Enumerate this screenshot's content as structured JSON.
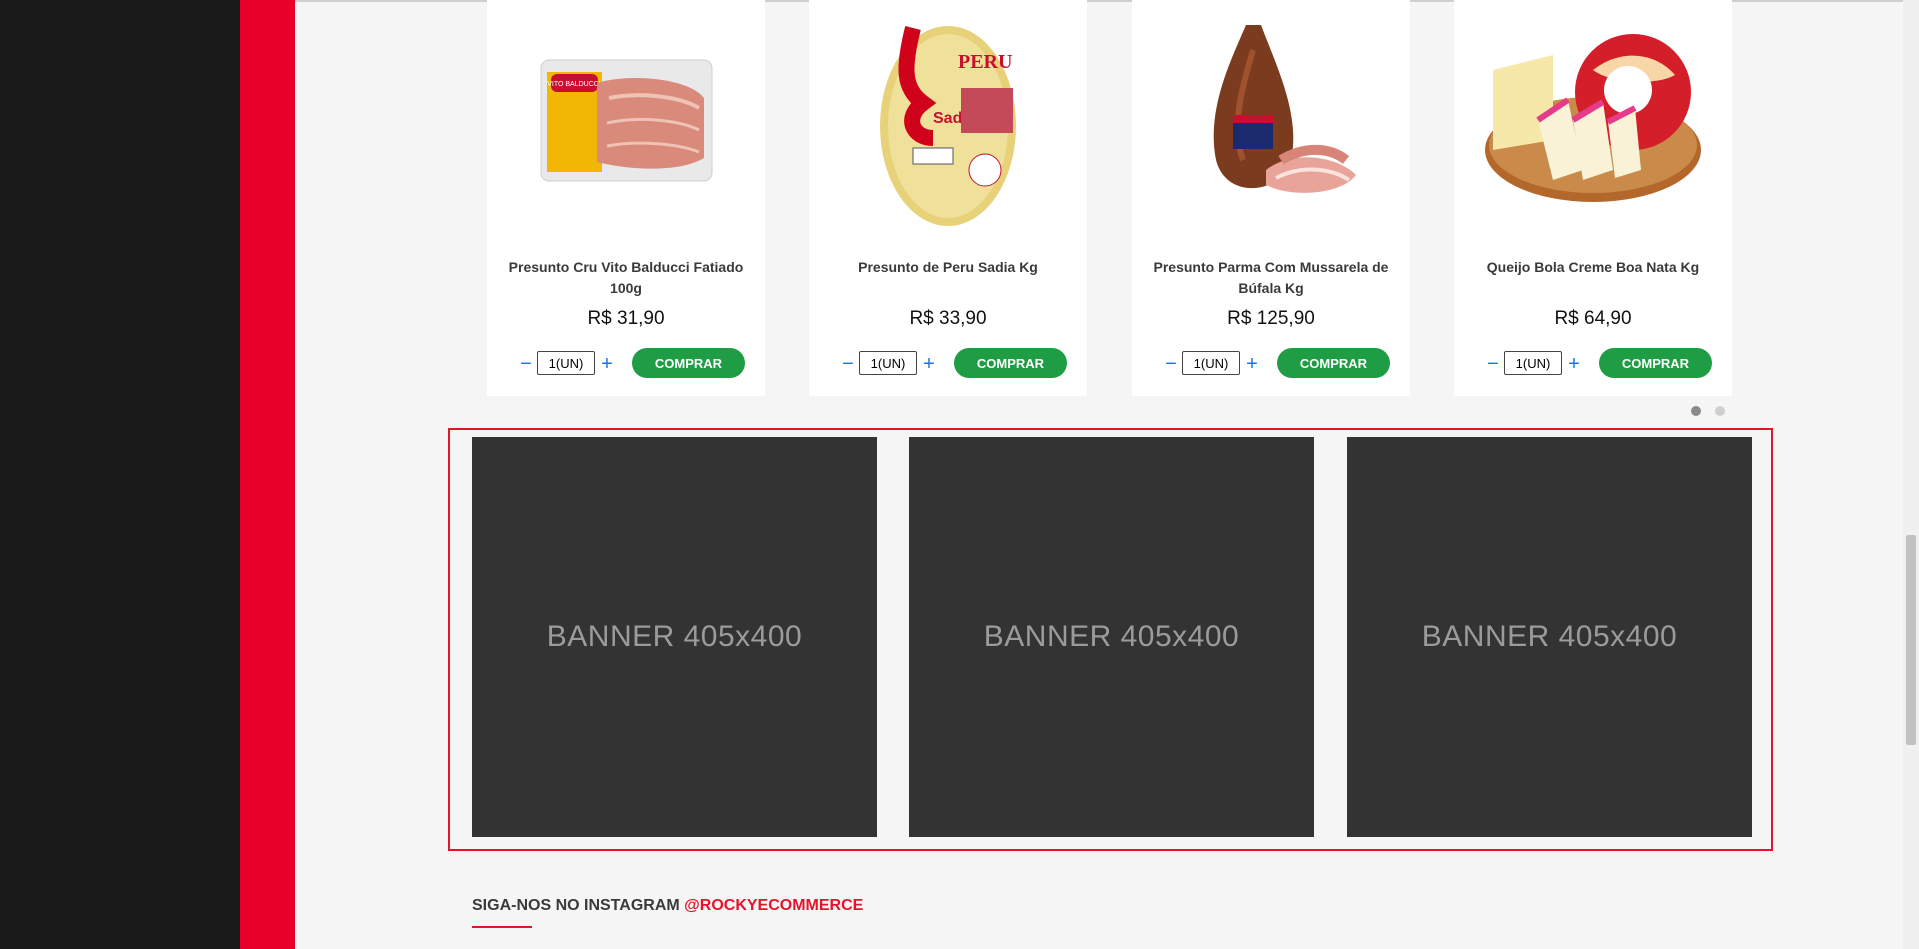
{
  "products": [
    {
      "name": "Presunto Cru Vito Balducci Fatiado 100g",
      "price": "R$ 31,90",
      "qty": "1(UN)",
      "buy_label": "COMPRAR",
      "image_icon": "prosciutto-pack-icon",
      "brand_text": "VITO BALDUCCI"
    },
    {
      "name": "Presunto de Peru Sadia Kg",
      "price": "R$ 33,90",
      "qty": "1(UN)",
      "buy_label": "COMPRAR",
      "image_icon": "turkey-ham-icon",
      "brand_text": "Sadia"
    },
    {
      "name": "Presunto Parma Com Mussarela de Búfala Kg",
      "price": "R$ 125,90",
      "qty": "1(UN)",
      "buy_label": "COMPRAR",
      "image_icon": "parma-ham-icon",
      "brand_text": ""
    },
    {
      "name": "Queijo Bola Creme Boa Nata Kg",
      "price": "R$ 64,90",
      "qty": "1(UN)",
      "buy_label": "COMPRAR",
      "image_icon": "cheese-ball-icon",
      "brand_text": ""
    }
  ],
  "carousel": {
    "pages": 2,
    "active": 0
  },
  "banners": [
    {
      "label": "BANNER 405x400"
    },
    {
      "label": "BANNER 405x400"
    },
    {
      "label": "BANNER 405x400"
    }
  ],
  "instagram": {
    "prefix": "SIGA-NOS NO INSTAGRAM",
    "handle": "@ROCKYECOMMERCE"
  },
  "colors": {
    "accent": "#e8002a",
    "buy_button": "#1f9d45",
    "banner_bg": "#333333",
    "sidebar_dark": "#1a1a1a"
  }
}
